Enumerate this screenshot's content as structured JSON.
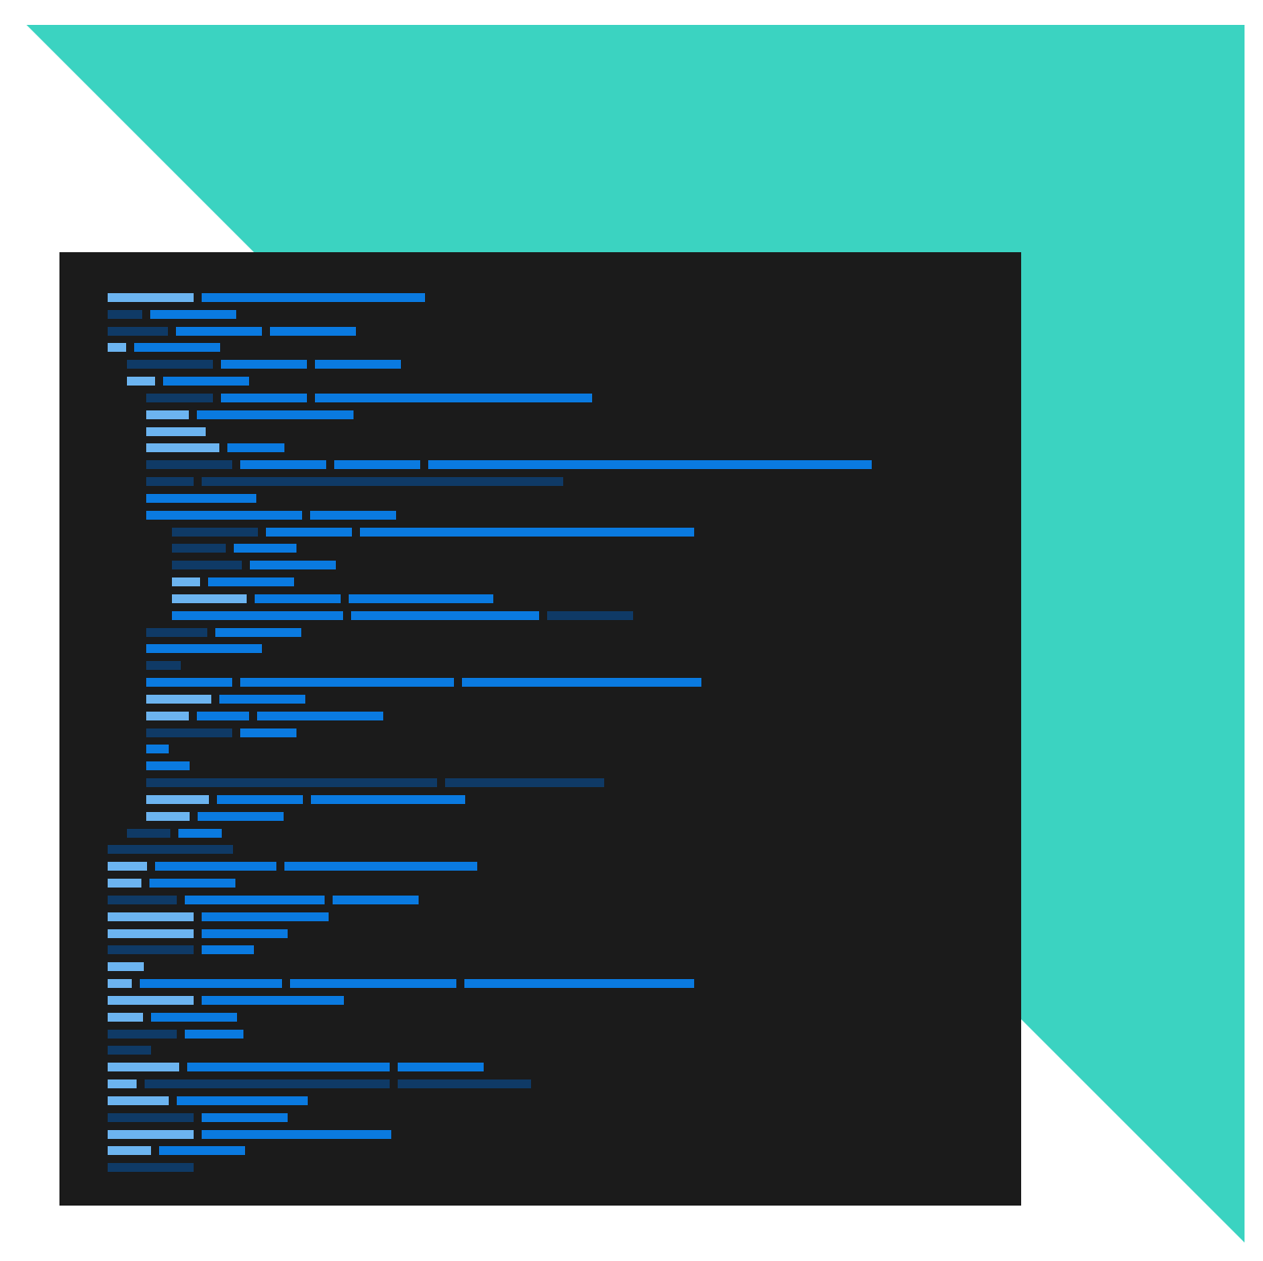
{
  "colors": {
    "background": "#ffffff",
    "accent": "#3bd3c1",
    "panel": "#1b1b1b",
    "token_light": "#6cb4f0",
    "token_mid": "#0a7ae0",
    "token_dark": "#0f3a66"
  },
  "code_panel": {
    "lines": [
      {
        "indent": 0,
        "tokens": [
          {
            "tone": "light",
            "len": 107
          },
          {
            "tone": "mid",
            "len": 278
          }
        ]
      },
      {
        "indent": 0,
        "tokens": [
          {
            "tone": "dark",
            "len": 43
          },
          {
            "tone": "mid",
            "len": 107
          }
        ]
      },
      {
        "indent": 0,
        "tokens": [
          {
            "tone": "dark",
            "len": 75
          },
          {
            "tone": "mid",
            "len": 107
          },
          {
            "tone": "mid",
            "len": 107
          }
        ]
      },
      {
        "indent": 0,
        "tokens": [
          {
            "tone": "light",
            "len": 23
          },
          {
            "tone": "mid",
            "len": 107
          }
        ]
      },
      {
        "indent": 1,
        "tokens": [
          {
            "tone": "dark",
            "len": 107
          },
          {
            "tone": "mid",
            "len": 107
          },
          {
            "tone": "mid",
            "len": 107
          }
        ]
      },
      {
        "indent": 1,
        "tokens": [
          {
            "tone": "light",
            "len": 35
          },
          {
            "tone": "mid",
            "len": 107
          }
        ]
      },
      {
        "indent": 2,
        "tokens": [
          {
            "tone": "dark",
            "len": 83
          },
          {
            "tone": "mid",
            "len": 107
          },
          {
            "tone": "mid",
            "len": 345
          }
        ]
      },
      {
        "indent": 2,
        "tokens": [
          {
            "tone": "light",
            "len": 53
          },
          {
            "tone": "mid",
            "len": 195
          }
        ]
      },
      {
        "indent": 2,
        "tokens": [
          {
            "tone": "light",
            "len": 74
          }
        ]
      },
      {
        "indent": 2,
        "tokens": [
          {
            "tone": "light",
            "len": 91
          },
          {
            "tone": "mid",
            "len": 71
          }
        ]
      },
      {
        "indent": 2,
        "tokens": [
          {
            "tone": "dark",
            "len": 107
          },
          {
            "tone": "mid",
            "len": 107
          },
          {
            "tone": "mid",
            "len": 107
          },
          {
            "tone": "mid",
            "len": 552
          }
        ]
      },
      {
        "indent": 2,
        "tokens": [
          {
            "tone": "dark",
            "len": 59
          },
          {
            "tone": "dark",
            "len": 450
          }
        ]
      },
      {
        "indent": 2,
        "tokens": [
          {
            "tone": "mid",
            "len": 137
          }
        ]
      },
      {
        "indent": 2,
        "tokens": [
          {
            "tone": "mid",
            "len": 194
          },
          {
            "tone": "mid",
            "len": 107
          }
        ]
      },
      {
        "indent": 3,
        "tokens": [
          {
            "tone": "dark",
            "len": 107
          },
          {
            "tone": "mid",
            "len": 107
          },
          {
            "tone": "mid",
            "len": 416
          }
        ]
      },
      {
        "indent": 3,
        "tokens": [
          {
            "tone": "dark",
            "len": 67
          },
          {
            "tone": "mid",
            "len": 78
          }
        ]
      },
      {
        "indent": 3,
        "tokens": [
          {
            "tone": "dark",
            "len": 87
          },
          {
            "tone": "mid",
            "len": 107
          }
        ]
      },
      {
        "indent": 3,
        "tokens": [
          {
            "tone": "light",
            "len": 35
          },
          {
            "tone": "mid",
            "len": 107
          }
        ]
      },
      {
        "indent": 3,
        "tokens": [
          {
            "tone": "light",
            "len": 93
          },
          {
            "tone": "mid",
            "len": 107
          },
          {
            "tone": "mid",
            "len": 180
          }
        ]
      },
      {
        "indent": 3,
        "tokens": [
          {
            "tone": "mid",
            "len": 213
          },
          {
            "tone": "mid",
            "len": 234
          },
          {
            "tone": "dark",
            "len": 107
          }
        ]
      },
      {
        "indent": 2,
        "tokens": [
          {
            "tone": "dark",
            "len": 76
          },
          {
            "tone": "mid",
            "len": 107
          }
        ]
      },
      {
        "indent": 2,
        "tokens": [
          {
            "tone": "mid",
            "len": 144
          }
        ]
      },
      {
        "indent": 2,
        "tokens": [
          {
            "tone": "dark",
            "len": 43
          }
        ]
      },
      {
        "indent": 2,
        "tokens": [
          {
            "tone": "mid",
            "len": 107
          },
          {
            "tone": "mid",
            "len": 266
          },
          {
            "tone": "mid",
            "len": 298
          }
        ]
      },
      {
        "indent": 2,
        "tokens": [
          {
            "tone": "light",
            "len": 81
          },
          {
            "tone": "mid",
            "len": 107
          }
        ]
      },
      {
        "indent": 2,
        "tokens": [
          {
            "tone": "light",
            "len": 53
          },
          {
            "tone": "mid",
            "len": 65
          },
          {
            "tone": "mid",
            "len": 157
          }
        ]
      },
      {
        "indent": 2,
        "tokens": [
          {
            "tone": "dark",
            "len": 107
          },
          {
            "tone": "mid",
            "len": 70
          }
        ]
      },
      {
        "indent": 2,
        "tokens": [
          {
            "tone": "mid",
            "len": 28
          }
        ]
      },
      {
        "indent": 2,
        "tokens": [
          {
            "tone": "mid",
            "len": 54
          }
        ]
      },
      {
        "indent": 2,
        "tokens": [
          {
            "tone": "dark",
            "len": 362
          },
          {
            "tone": "dark",
            "len": 198
          }
        ]
      },
      {
        "indent": 2,
        "tokens": [
          {
            "tone": "light",
            "len": 78
          },
          {
            "tone": "mid",
            "len": 107
          },
          {
            "tone": "mid",
            "len": 192
          }
        ]
      },
      {
        "indent": 2,
        "tokens": [
          {
            "tone": "light",
            "len": 54
          },
          {
            "tone": "mid",
            "len": 107
          }
        ]
      },
      {
        "indent": 1,
        "tokens": [
          {
            "tone": "dark",
            "len": 54
          },
          {
            "tone": "mid",
            "len": 54
          }
        ]
      },
      {
        "indent": 0,
        "tokens": [
          {
            "tone": "dark",
            "len": 156
          }
        ]
      },
      {
        "indent": 0,
        "tokens": [
          {
            "tone": "light",
            "len": 49
          },
          {
            "tone": "mid",
            "len": 151
          },
          {
            "tone": "mid",
            "len": 240
          }
        ]
      },
      {
        "indent": 0,
        "tokens": [
          {
            "tone": "light",
            "len": 42
          },
          {
            "tone": "mid",
            "len": 107
          }
        ]
      },
      {
        "indent": 0,
        "tokens": [
          {
            "tone": "dark",
            "len": 86
          },
          {
            "tone": "mid",
            "len": 174
          },
          {
            "tone": "mid",
            "len": 107
          }
        ]
      },
      {
        "indent": 0,
        "tokens": [
          {
            "tone": "light",
            "len": 107
          },
          {
            "tone": "mid",
            "len": 158
          }
        ]
      },
      {
        "indent": 0,
        "tokens": [
          {
            "tone": "light",
            "len": 107
          },
          {
            "tone": "mid",
            "len": 107
          }
        ]
      },
      {
        "indent": 0,
        "tokens": [
          {
            "tone": "dark",
            "len": 107
          },
          {
            "tone": "mid",
            "len": 65
          }
        ]
      },
      {
        "indent": 0,
        "tokens": [
          {
            "tone": "light",
            "len": 45
          }
        ]
      },
      {
        "indent": 0,
        "tokens": [
          {
            "tone": "light",
            "len": 30
          },
          {
            "tone": "mid",
            "len": 177
          },
          {
            "tone": "mid",
            "len": 207
          },
          {
            "tone": "mid",
            "len": 286
          }
        ]
      },
      {
        "indent": 0,
        "tokens": [
          {
            "tone": "light",
            "len": 107
          },
          {
            "tone": "mid",
            "len": 177
          }
        ]
      },
      {
        "indent": 0,
        "tokens": [
          {
            "tone": "light",
            "len": 44
          },
          {
            "tone": "mid",
            "len": 107
          }
        ]
      },
      {
        "indent": 0,
        "tokens": [
          {
            "tone": "dark",
            "len": 86
          },
          {
            "tone": "mid",
            "len": 73
          }
        ]
      },
      {
        "indent": 0,
        "tokens": [
          {
            "tone": "dark",
            "len": 54
          }
        ]
      },
      {
        "indent": 0,
        "tokens": [
          {
            "tone": "light",
            "len": 89
          },
          {
            "tone": "mid",
            "len": 252
          },
          {
            "tone": "mid",
            "len": 107
          }
        ]
      },
      {
        "indent": 0,
        "tokens": [
          {
            "tone": "light",
            "len": 36
          },
          {
            "tone": "dark",
            "len": 305
          },
          {
            "tone": "dark",
            "len": 166
          }
        ]
      },
      {
        "indent": 0,
        "tokens": [
          {
            "tone": "light",
            "len": 76
          },
          {
            "tone": "mid",
            "len": 163
          }
        ]
      },
      {
        "indent": 0,
        "tokens": [
          {
            "tone": "dark",
            "len": 107
          },
          {
            "tone": "mid",
            "len": 107
          }
        ]
      },
      {
        "indent": 0,
        "tokens": [
          {
            "tone": "light",
            "len": 107
          },
          {
            "tone": "mid",
            "len": 236
          }
        ]
      },
      {
        "indent": 0,
        "tokens": [
          {
            "tone": "light",
            "len": 54
          },
          {
            "tone": "mid",
            "len": 107
          }
        ]
      },
      {
        "indent": 0,
        "tokens": [
          {
            "tone": "dark",
            "len": 107
          }
        ]
      }
    ]
  }
}
